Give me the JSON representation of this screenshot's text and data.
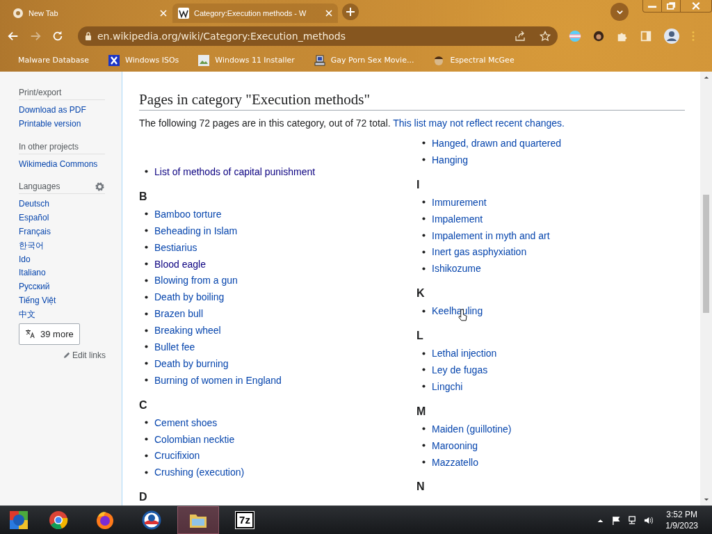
{
  "browser": {
    "tabs": [
      {
        "title": "New Tab",
        "selected": false
      },
      {
        "title": "Category:Execution methods - W",
        "selected": true
      }
    ],
    "address": "en.wikipedia.org/wiki/Category:Execution_methods",
    "bookmarks": [
      "Malware Database",
      "Windows ISOs",
      "Windows 11 Installer",
      "Gay Porn Sex Movie...",
      "Espectral McGee"
    ]
  },
  "sidebar": {
    "sections": [
      {
        "heading": "Print/export",
        "links": [
          "Download as PDF",
          "Printable version"
        ]
      },
      {
        "heading": "In other projects",
        "links": [
          "Wikimedia Commons"
        ]
      },
      {
        "heading": "Languages",
        "links": [
          "Deutsch",
          "Español",
          "Français",
          "한국어",
          "Ido",
          "Italiano",
          "Русский",
          "Tiếng Việt",
          "中文"
        ]
      }
    ],
    "more_button": "39 more",
    "edit_links": "Edit links"
  },
  "content": {
    "heading": "Pages in category \"Execution methods\"",
    "intro": "The following 72 pages are in this category, out of 72 total.",
    "intro_link": "This list may not reflect recent changes.",
    "columns": [
      {
        "groups": [
          {
            "items": [
              {
                "label": "List of methods of capital punishment",
                "visited": true
              }
            ]
          },
          {
            "heading": "B",
            "items": [
              {
                "label": "Bamboo torture",
                "visited": false
              },
              {
                "label": "Beheading in Islam",
                "visited": false
              },
              {
                "label": "Bestiarius",
                "visited": false
              },
              {
                "label": "Blood eagle",
                "visited": true
              },
              {
                "label": "Blowing from a gun",
                "visited": false
              },
              {
                "label": "Death by boiling",
                "visited": false
              },
              {
                "label": "Brazen bull",
                "visited": false
              },
              {
                "label": "Breaking wheel",
                "visited": false
              },
              {
                "label": "Bullet fee",
                "visited": false
              },
              {
                "label": "Death by burning",
                "visited": false
              },
              {
                "label": "Burning of women in England",
                "visited": false
              }
            ]
          },
          {
            "heading": "C",
            "items": [
              {
                "label": "Cement shoes",
                "visited": false
              },
              {
                "label": "Colombian necktie",
                "visited": false
              },
              {
                "label": "Crucifixion",
                "visited": false
              },
              {
                "label": "Crushing (execution)",
                "visited": false
              }
            ]
          },
          {
            "heading": "D"
          }
        ]
      },
      {
        "groups": [
          {
            "items": [
              {
                "label": "Hanged, drawn and quartered",
                "visited": false
              },
              {
                "label": "Hanging",
                "visited": false
              }
            ]
          },
          {
            "heading": "I",
            "items": [
              {
                "label": "Immurement",
                "visited": false
              },
              {
                "label": "Impalement",
                "visited": false
              },
              {
                "label": "Impalement in myth and art",
                "visited": false
              },
              {
                "label": "Inert gas asphyxiation",
                "visited": false
              },
              {
                "label": "Ishikozume",
                "visited": false
              }
            ]
          },
          {
            "heading": "K",
            "items": [
              {
                "label": "Keelhauling",
                "visited": false
              }
            ]
          },
          {
            "heading": "L",
            "items": [
              {
                "label": "Lethal injection",
                "visited": false
              },
              {
                "label": "Ley de fugas",
                "visited": false
              },
              {
                "label": "Lingchi",
                "visited": false
              }
            ]
          },
          {
            "heading": "M",
            "items": [
              {
                "label": "Maiden (guillotine)",
                "visited": false
              },
              {
                "label": "Marooning",
                "visited": false
              },
              {
                "label": "Mazzatello",
                "visited": false
              }
            ]
          },
          {
            "heading": "N"
          }
        ]
      }
    ]
  },
  "taskbar": {
    "apps": [
      {
        "kind": "start",
        "active": false
      },
      {
        "kind": "chrome",
        "active": false
      },
      {
        "kind": "firefox",
        "active": false
      },
      {
        "kind": "circle-logo",
        "active": false
      },
      {
        "kind": "folder",
        "active": true
      },
      {
        "kind": "sevenzip",
        "active": false,
        "label": "7z"
      }
    ],
    "time": "3:52 PM",
    "date": "1/9/2023"
  }
}
